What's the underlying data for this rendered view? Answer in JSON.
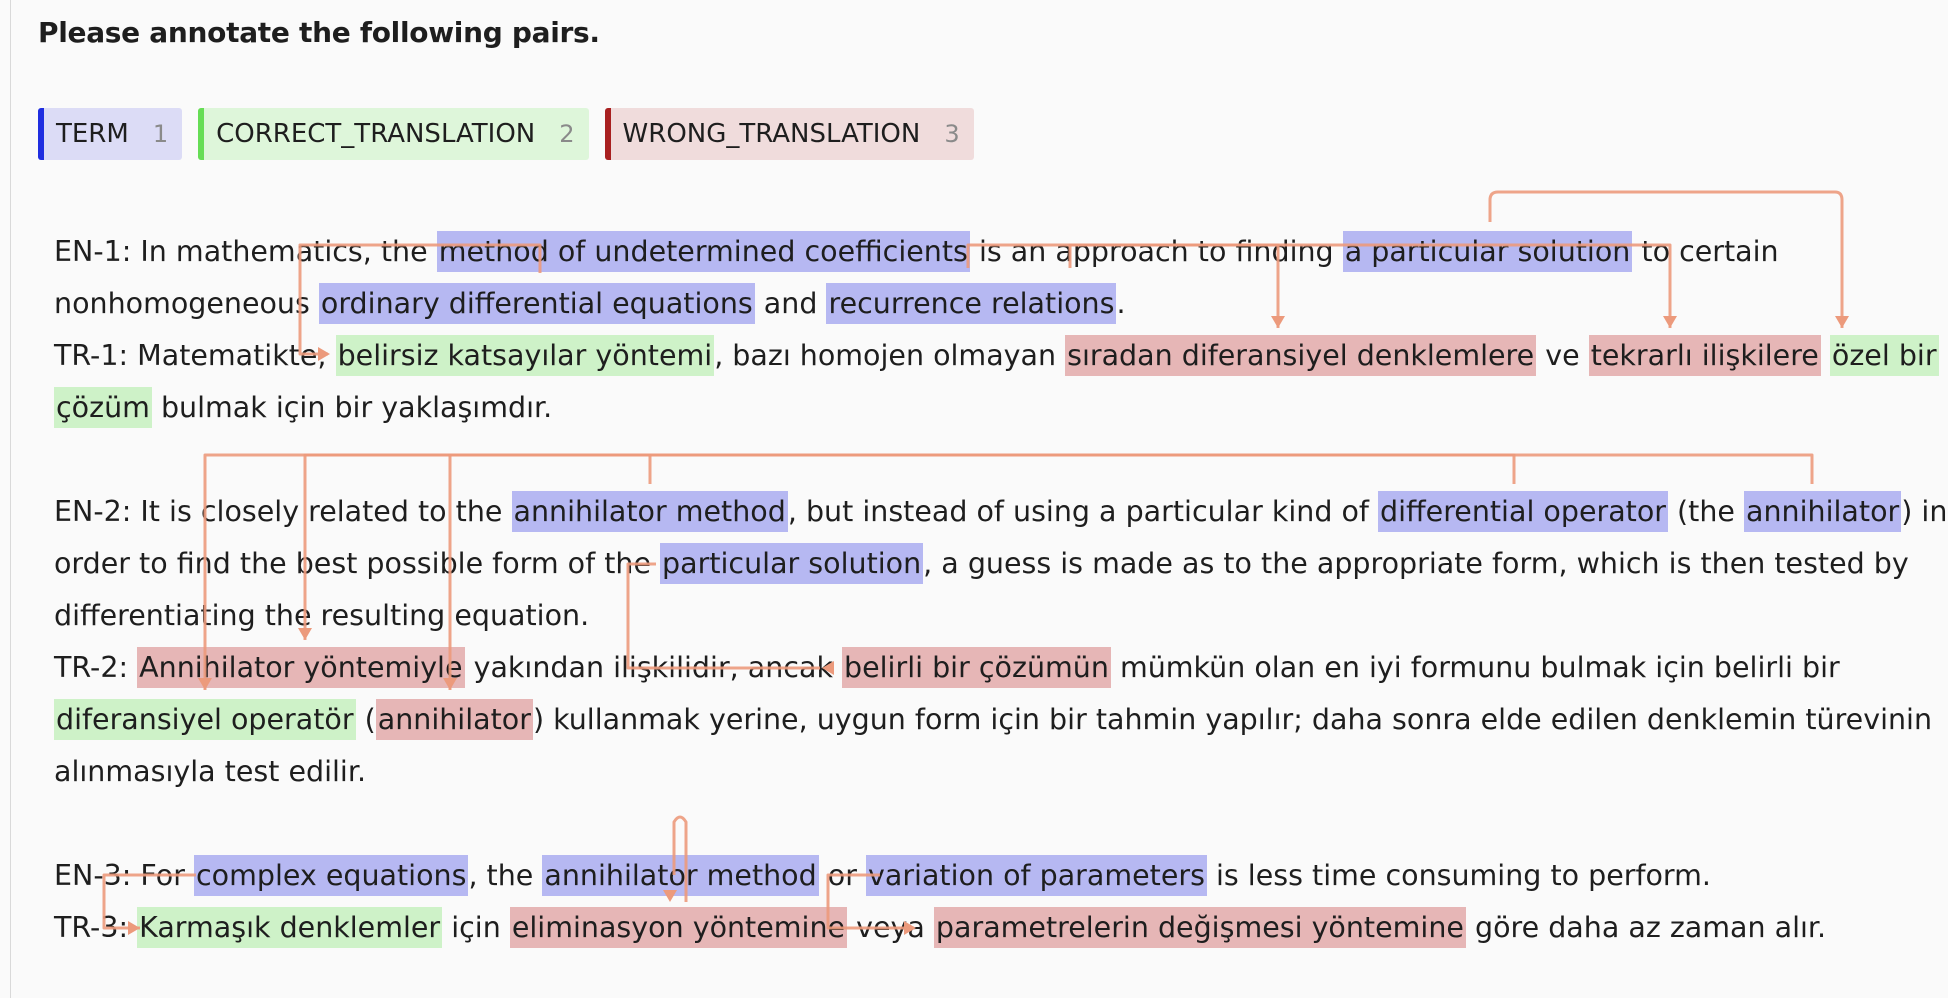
{
  "title": "Please annotate the following pairs.",
  "labels": [
    {
      "name": "TERM",
      "key": "1",
      "color": "#1f2ee0"
    },
    {
      "name": "CORRECT_TRANSLATION",
      "key": "2",
      "color": "#66dd55"
    },
    {
      "name": "WRONG_TRANSLATION",
      "key": "3",
      "color": "#a82020"
    }
  ],
  "lines": [
    [
      {
        "t": "EN-1: In mathematics, the "
      },
      {
        "t": "method of undetermined coefficients",
        "c": "term"
      },
      {
        "t": " is an approach to finding "
      },
      {
        "t": "a particular solution",
        "c": "term"
      },
      {
        "t": " to certain"
      }
    ],
    [
      {
        "t": "nonhomogeneous "
      },
      {
        "t": "ordinary differential equations",
        "c": "term"
      },
      {
        "t": " and "
      },
      {
        "t": "recurrence relations",
        "c": "term"
      },
      {
        "t": "."
      }
    ],
    [
      {
        "t": "TR-1: Matematikte, "
      },
      {
        "t": "belirsiz katsayılar yöntemi",
        "c": "correct"
      },
      {
        "t": ", bazı homojen olmayan "
      },
      {
        "t": "sıradan diferansiyel denklemlere",
        "c": "wrong"
      },
      {
        "t": " ve "
      },
      {
        "t": "tekrarlı ilişkilere",
        "c": "wrong"
      },
      {
        "t": " "
      },
      {
        "t": "özel bir",
        "c": "correct"
      }
    ],
    [
      {
        "t": "çözüm",
        "c": "correct"
      },
      {
        "t": " bulmak için bir yaklaşımdır."
      }
    ],
    [],
    [
      {
        "t": "EN-2: It is closely related to the "
      },
      {
        "t": "annihilator method",
        "c": "term"
      },
      {
        "t": ", but instead of using a particular kind of "
      },
      {
        "t": "differential operator",
        "c": "term"
      },
      {
        "t": " (the "
      },
      {
        "t": "annihilator",
        "c": "term"
      },
      {
        "t": ") in"
      }
    ],
    [
      {
        "t": "order to find the best possible form of the "
      },
      {
        "t": "particular solution",
        "c": "term"
      },
      {
        "t": ", a guess is made as to the appropriate form, which is then tested by"
      }
    ],
    [
      {
        "t": "differentiating the resulting equation."
      }
    ],
    [
      {
        "t": "TR-2: "
      },
      {
        "t": "Annihilator yöntemiyle",
        "c": "wrong"
      },
      {
        "t": " yakından ilişkilidir, ancak "
      },
      {
        "t": "belirli bir çözümün",
        "c": "wrong"
      },
      {
        "t": " mümkün olan en iyi formunu bulmak için belirli bir"
      }
    ],
    [
      {
        "t": "diferansiyel operatör",
        "c": "correct"
      },
      {
        "t": " ("
      },
      {
        "t": "annihilator",
        "c": "wrong"
      },
      {
        "t": ") kullanmak yerine, uygun form için bir tahmin yapılır; daha sonra elde edilen denklemin türevinin"
      }
    ],
    [
      {
        "t": "alınmasıyla test edilir."
      }
    ],
    [],
    [
      {
        "t": "EN-3: For "
      },
      {
        "t": "complex equations",
        "c": "term"
      },
      {
        "t": ", the "
      },
      {
        "t": "annihilator method",
        "c": "term"
      },
      {
        "t": " or "
      },
      {
        "t": "variation of parameters",
        "c": "term"
      },
      {
        "t": " is less time consuming to perform."
      }
    ],
    [
      {
        "t": "TR-3: "
      },
      {
        "t": "Karmaşık denklemler",
        "c": "correct"
      },
      {
        "t": " için "
      },
      {
        "t": "eliminasyon yöntemine",
        "c": "wrong"
      },
      {
        "t": " veya "
      },
      {
        "t": "parametrelerin değişmesi yöntemine",
        "c": "wrong"
      },
      {
        "t": " göre daha az zaman alır."
      }
    ]
  ]
}
